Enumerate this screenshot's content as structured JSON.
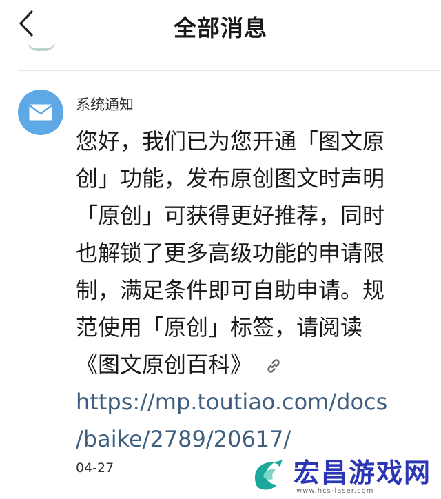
{
  "header": {
    "title": "全部消息"
  },
  "notification": {
    "sender": "系统通知",
    "lines": [
      "您好，我们已为您开通「图文原",
      "创」功能，发布原创图文时声明",
      "「原创」可获得更好推荐，同时",
      "也解锁了更多高级功能的申请限",
      "制，满足条件即可自助申请。规",
      "范使用「原创」标签，请阅读"
    ],
    "link_text": "《图文原创百科》",
    "url_lines": [
      "https://mp.toutiao.com/docs",
      "/baike/2789/20617/"
    ],
    "date": "04-27"
  },
  "watermark": {
    "title": "宏昌游戏网",
    "url": "www.hcs-laser.com"
  },
  "icons": {
    "back": "chevron-left-icon",
    "avatar": "envelope-icon",
    "link": "link-icon"
  },
  "colors": {
    "avatar_bg": "#5ea8e6",
    "link": "#3e5f7f",
    "watermark_text": "#2b36b5"
  }
}
